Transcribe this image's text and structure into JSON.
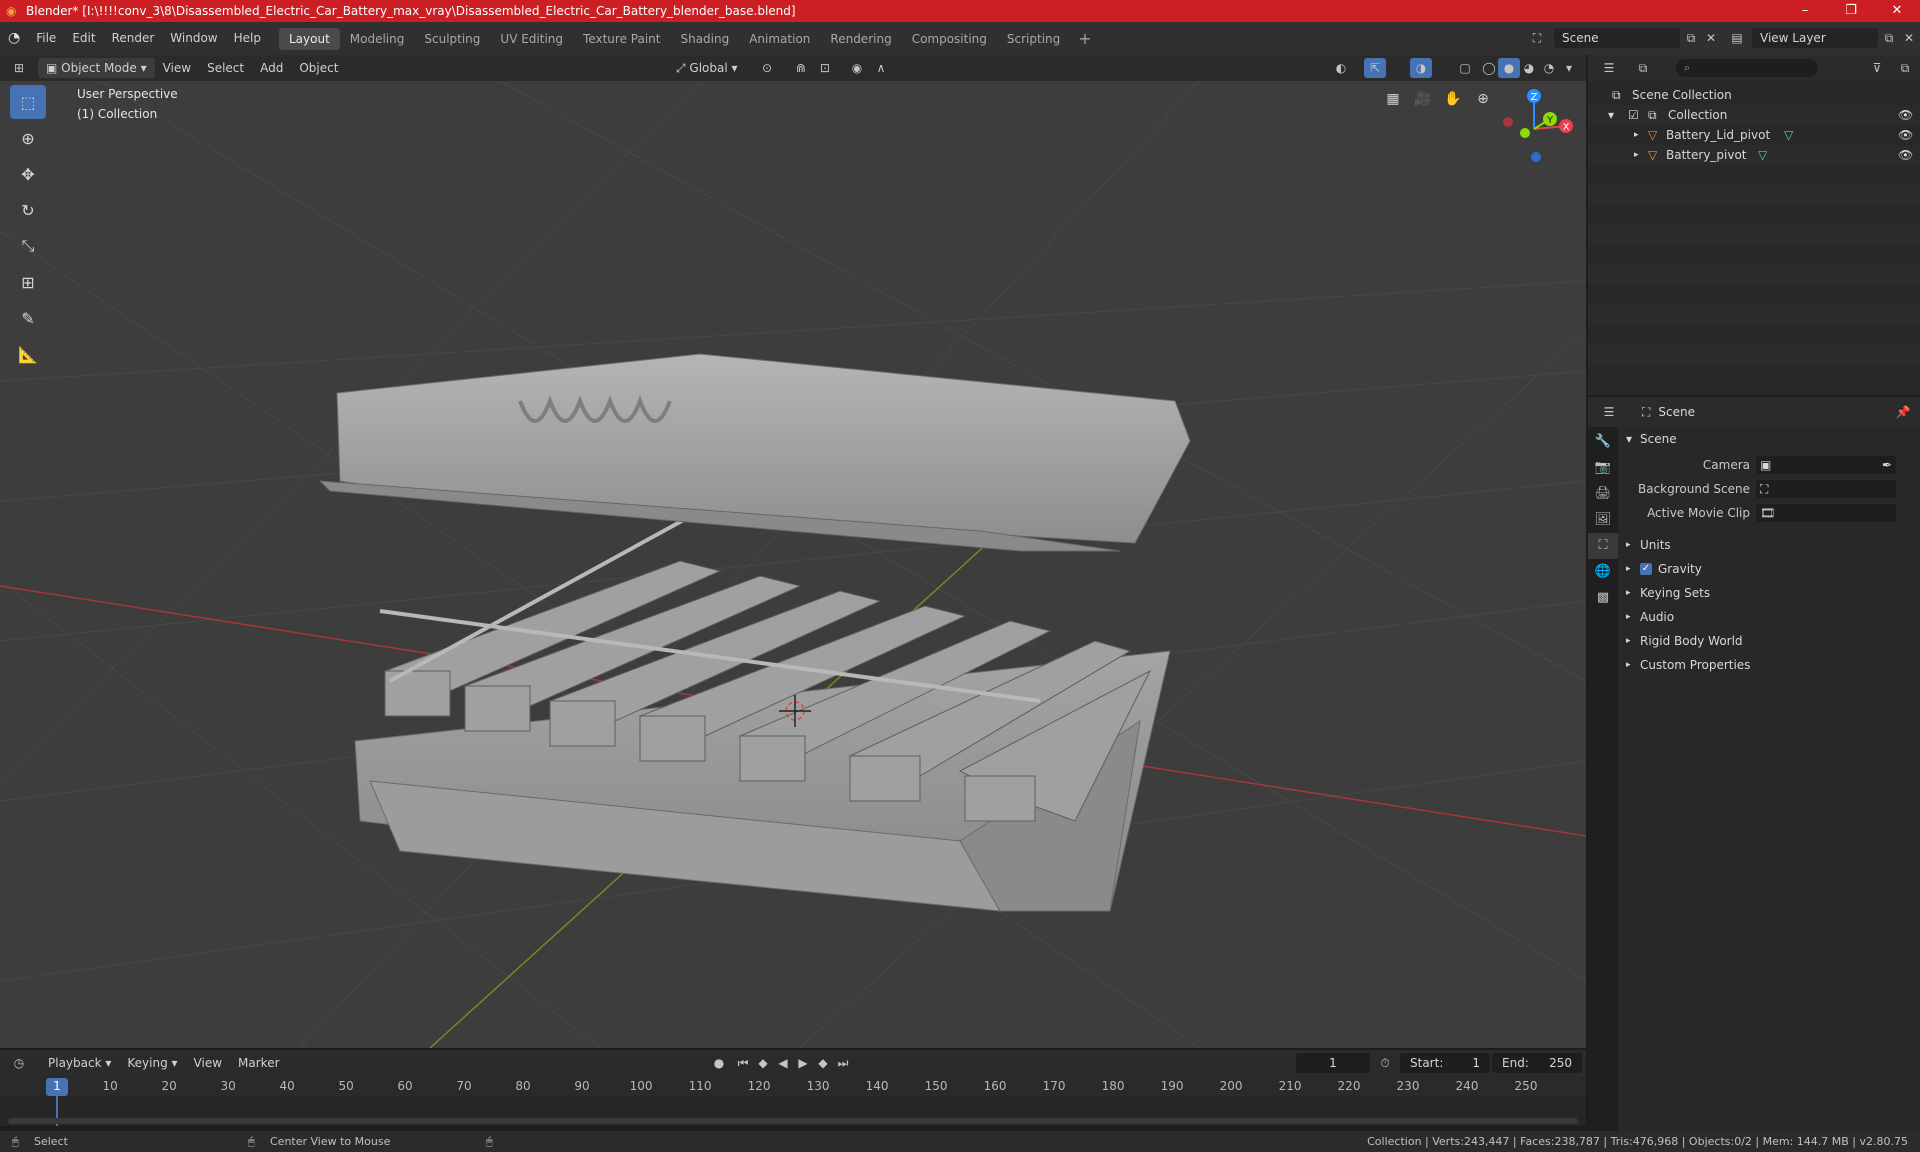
{
  "title_bar": {
    "text": "Blender* [I:\\!!!!conv_3\\8\\Disassembled_Electric_Car_Battery_max_vray\\Disassembled_Electric_Car_Battery_blender_base.blend]",
    "minimize": "–",
    "maximize": "❐",
    "close": "✕"
  },
  "menu": [
    "File",
    "Edit",
    "Render",
    "Window",
    "Help"
  ],
  "workspaces": [
    "Layout",
    "Modeling",
    "Sculpting",
    "UV Editing",
    "Texture Paint",
    "Shading",
    "Animation",
    "Rendering",
    "Compositing",
    "Scripting"
  ],
  "active_workspace": "Layout",
  "scene_name": "Scene",
  "view_layer": "View Layer",
  "viewport_header": {
    "mode": "Object Mode",
    "menus": [
      "View",
      "Select",
      "Add",
      "Object"
    ],
    "transform_orientation": "Global"
  },
  "viewport_info": {
    "perspective": "User Perspective",
    "collection": "(1) Collection"
  },
  "gizmo": {
    "x": "X",
    "y": "Y",
    "z": "Z"
  },
  "outliner": {
    "root": "Scene Collection",
    "collection": "Collection",
    "objects": [
      "Battery_Lid_pivot",
      "Battery_pivot"
    ]
  },
  "properties": {
    "header_title": "Scene",
    "panel_title": "Scene",
    "fields": [
      {
        "label": "Camera"
      },
      {
        "label": "Background Scene"
      },
      {
        "label": "Active Movie Clip"
      }
    ],
    "sections": [
      "Units",
      "Gravity",
      "Keying Sets",
      "Audio",
      "Rigid Body World",
      "Custom Properties"
    ],
    "gravity_checked": true
  },
  "timeline": {
    "menus": [
      "Playback",
      "Keying",
      "View",
      "Marker"
    ],
    "current_frame": "1",
    "start_label": "Start:",
    "start": "1",
    "end_label": "End:",
    "end": "250",
    "frame_marks": [
      "1",
      "10",
      "20",
      "30",
      "40",
      "50",
      "60",
      "70",
      "80",
      "90",
      "100",
      "110",
      "120",
      "130",
      "140",
      "150",
      "160",
      "170",
      "180",
      "190",
      "200",
      "210",
      "220",
      "230",
      "240",
      "250"
    ]
  },
  "statusbar": {
    "left": "Select",
    "middle": "Center View to Mouse",
    "right": "Collection | Verts:243,447 | Faces:238,787 | Tris:476,968 | Objects:0/2 | Mem: 144.7 MB | v2.80.75"
  },
  "colors": {
    "title_bar": "#cc1f24",
    "active_tool": "#4772b3",
    "x_axis": "#e5424d",
    "y_axis": "#8bdc00",
    "z_axis": "#2c8fff",
    "grid_line": "#474747",
    "mesh": "#a9a9a9"
  }
}
